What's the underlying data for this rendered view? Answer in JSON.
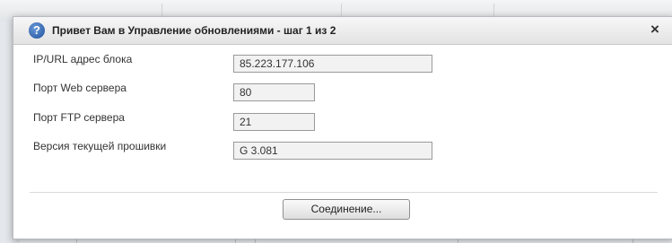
{
  "dialog": {
    "title": "Привет Вам в Управление обновлениями - шаг 1 из 2",
    "help_icon_glyph": "?",
    "close_icon_glyph": "×"
  },
  "form": {
    "ip_label": "IP/URL адрес  блока",
    "ip_value": "85.223.177.106",
    "web_port_label": "Порт Web сервера",
    "web_port_value": "80",
    "ftp_port_label": "Порт FTP сервера",
    "ftp_port_value": "21",
    "firmware_label": "Версия текущей прошивки",
    "firmware_value": "G 3.081"
  },
  "actions": {
    "connect_label": "Соединение..."
  },
  "colors": {
    "field_background": "#f2f2f2",
    "field_border": "#9a9a9a",
    "help_icon": "#1f4f9a"
  }
}
